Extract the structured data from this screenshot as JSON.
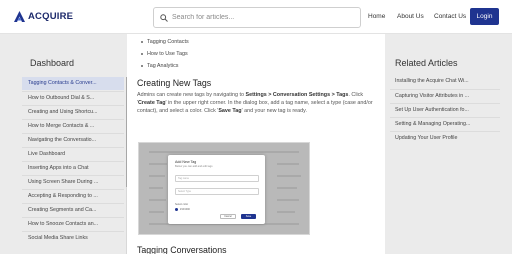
{
  "header": {
    "logo_text": "ACQUIRE",
    "search_placeholder": "Search for articles...",
    "nav": [
      "Home",
      "About Us",
      "Contact Us"
    ],
    "login_label": "Login"
  },
  "left_sidebar": {
    "title": "Dashboard",
    "items": [
      "Tagging Contacts & Conver...",
      "How to Outbound Dial & S...",
      "Creating and Using Shortcu...",
      "How to Merge Contacts & ...",
      "Navigating the Conversatio...",
      "Live Dashboard",
      "Inserting Apps into a Chat",
      "Using Screen Share During ...",
      "Accepting & Responding to ...",
      "Creating Segments and Ca...",
      "How to Snooze Contacts an...",
      "Social Media Share Links"
    ]
  },
  "article": {
    "bullets": [
      "Tagging Contacts",
      "How to Use Tags",
      "Tag Analytics"
    ],
    "heading": "Creating New Tags",
    "para": {
      "p1": "Admins can create new tags by navigating to ",
      "b1": "Settings > Conversation Settings > Tags",
      "p2": ". Click '",
      "b2": "Create Tag",
      "p3": "' in the upper right corner. In the dialog box, add a tag name, select a type (case and/or contact), and select a color. Click '",
      "b3": "Save Tag",
      "p4": "' and your new tag is ready."
    },
    "dialog": {
      "title": "Add New Tag",
      "subtitle": "Below you can add and edit tags",
      "name_placeholder": "Tag name",
      "type_placeholder": "Select Type",
      "color_label": "Select color",
      "color_value": "#1F3490",
      "cancel": "Cancel",
      "save": "Save"
    },
    "heading2": "Tagging Conversations"
  },
  "right_sidebar": {
    "title": "Related Articles",
    "items": [
      "Installing the Acquire Chat Wi...",
      "Capturing Visitor Attributes in ...",
      "Set Up User Authentication fo...",
      "Setting & Managing Operating...",
      "Updating Your User Profile"
    ]
  },
  "colors": {
    "brand": "#1f3490",
    "active_bg": "#d7dded",
    "page_bg": "#ebebeb"
  }
}
